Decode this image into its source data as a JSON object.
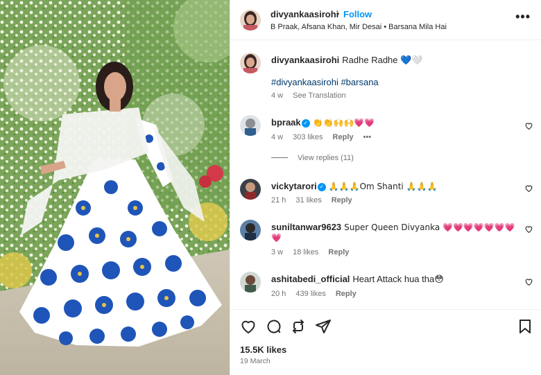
{
  "post": {
    "username": "divyankaasirohi",
    "dot": "•",
    "follow_label": "Follow",
    "audio": "B Praak, Afsana Khan, Mir Desai • Barsana Mila Hai",
    "more_label": "•••"
  },
  "caption": {
    "username": "divyankaasirohi",
    "text": "Radhe Radhe 💙🤍",
    "hashtags": "#divyankaasirohi #barsana",
    "age": "4 w",
    "translate": "See Translation"
  },
  "comments": [
    {
      "username": "bpraak",
      "verified": true,
      "text": "👏👏🙌🙌💗💗",
      "age": "4 w",
      "likes": "303 likes",
      "reply": "Reply",
      "more": "•••"
    },
    {
      "username": "vickytarori",
      "verified": true,
      "text": "🙏🙏🙏Om Shanti 🙏🙏🙏",
      "age": "21 h",
      "likes": "31 likes",
      "reply": "Reply"
    },
    {
      "username": "suniltanwar9623",
      "verified": false,
      "text": "Super Queen Divyanka 💗💗💗💗💗💗💗",
      "text2": "💗",
      "age": "3 w",
      "likes": "18 likes",
      "reply": "Reply"
    },
    {
      "username": "ashitabedi_official",
      "verified": false,
      "text": "Heart Attack hua tha😳",
      "age": "20 h",
      "likes": "439 likes",
      "reply": "Reply"
    }
  ],
  "view_replies": "View replies (11)",
  "footer": {
    "likes": "15.5K likes",
    "date": "19 March"
  },
  "icons": {
    "like": "heart-icon",
    "comment": "comment-icon",
    "share": "repost-icon",
    "send": "send-icon",
    "save": "bookmark-icon"
  },
  "colors": {
    "follow": "#0095f6",
    "hashtag": "#00376b",
    "secondary_text": "#737373",
    "verified": "#0095f6"
  }
}
